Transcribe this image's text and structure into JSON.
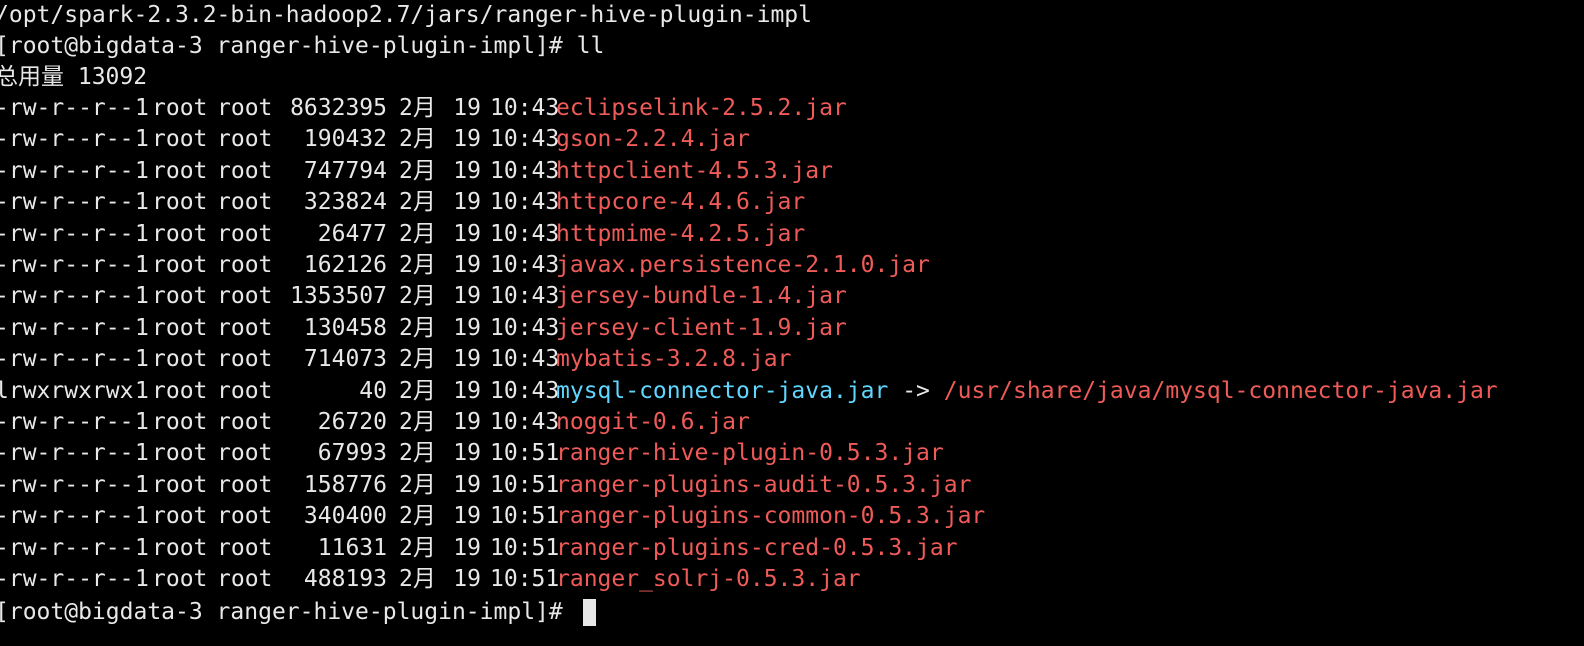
{
  "terminal": {
    "path_line": "/opt/spark-2.3.2-bin-hadoop2.7/jars/ranger-hive-plugin-impl",
    "prompt": "[root@bigdata-3 ranger-hive-plugin-impl]# ",
    "command": "ll",
    "total_line": "总用量 13092",
    "final_prompt": "[root@bigdata-3 ranger-hive-plugin-impl]# ",
    "colors": {
      "background": "#000000",
      "text": "#e8e8e8",
      "file": "#ef5b58",
      "symlink": "#5fd7ff"
    }
  },
  "listing": [
    {
      "perms": "-rw-r--r--",
      "links": "1",
      "owner": "root",
      "group": "root",
      "size": "8632395",
      "month": "2月",
      "day": "19",
      "time": "10:43",
      "name": "eclipselink-2.5.2.jar"
    },
    {
      "perms": "-rw-r--r--",
      "links": "1",
      "owner": "root",
      "group": "root",
      "size": "190432",
      "month": "2月",
      "day": "19",
      "time": "10:43",
      "name": "gson-2.2.4.jar"
    },
    {
      "perms": "-rw-r--r--",
      "links": "1",
      "owner": "root",
      "group": "root",
      "size": "747794",
      "month": "2月",
      "day": "19",
      "time": "10:43",
      "name": "httpclient-4.5.3.jar"
    },
    {
      "perms": "-rw-r--r--",
      "links": "1",
      "owner": "root",
      "group": "root",
      "size": "323824",
      "month": "2月",
      "day": "19",
      "time": "10:43",
      "name": "httpcore-4.4.6.jar"
    },
    {
      "perms": "-rw-r--r--",
      "links": "1",
      "owner": "root",
      "group": "root",
      "size": "26477",
      "month": "2月",
      "day": "19",
      "time": "10:43",
      "name": "httpmime-4.2.5.jar"
    },
    {
      "perms": "-rw-r--r--",
      "links": "1",
      "owner": "root",
      "group": "root",
      "size": "162126",
      "month": "2月",
      "day": "19",
      "time": "10:43",
      "name": "javax.persistence-2.1.0.jar"
    },
    {
      "perms": "-rw-r--r--",
      "links": "1",
      "owner": "root",
      "group": "root",
      "size": "1353507",
      "month": "2月",
      "day": "19",
      "time": "10:43",
      "name": "jersey-bundle-1.4.jar"
    },
    {
      "perms": "-rw-r--r--",
      "links": "1",
      "owner": "root",
      "group": "root",
      "size": "130458",
      "month": "2月",
      "day": "19",
      "time": "10:43",
      "name": "jersey-client-1.9.jar"
    },
    {
      "perms": "-rw-r--r--",
      "links": "1",
      "owner": "root",
      "group": "root",
      "size": "714073",
      "month": "2月",
      "day": "19",
      "time": "10:43",
      "name": "mybatis-3.2.8.jar"
    },
    {
      "perms": "lrwxrwxrwx",
      "links": "1",
      "owner": "root",
      "group": "root",
      "size": "40",
      "month": "2月",
      "day": "19",
      "time": "10:43",
      "name": "mysql-connector-java.jar",
      "arrow": "->",
      "target": "/usr/share/java/mysql-connector-java.jar"
    },
    {
      "perms": "-rw-r--r--",
      "links": "1",
      "owner": "root",
      "group": "root",
      "size": "26720",
      "month": "2月",
      "day": "19",
      "time": "10:43",
      "name": "noggit-0.6.jar"
    },
    {
      "perms": "-rw-r--r--",
      "links": "1",
      "owner": "root",
      "group": "root",
      "size": "67993",
      "month": "2月",
      "day": "19",
      "time": "10:51",
      "name": "ranger-hive-plugin-0.5.3.jar"
    },
    {
      "perms": "-rw-r--r--",
      "links": "1",
      "owner": "root",
      "group": "root",
      "size": "158776",
      "month": "2月",
      "day": "19",
      "time": "10:51",
      "name": "ranger-plugins-audit-0.5.3.jar"
    },
    {
      "perms": "-rw-r--r--",
      "links": "1",
      "owner": "root",
      "group": "root",
      "size": "340400",
      "month": "2月",
      "day": "19",
      "time": "10:51",
      "name": "ranger-plugins-common-0.5.3.jar"
    },
    {
      "perms": "-rw-r--r--",
      "links": "1",
      "owner": "root",
      "group": "root",
      "size": "11631",
      "month": "2月",
      "day": "19",
      "time": "10:51",
      "name": "ranger-plugins-cred-0.5.3.jar"
    },
    {
      "perms": "-rw-r--r--",
      "links": "1",
      "owner": "root",
      "group": "root",
      "size": "488193",
      "month": "2月",
      "day": "19",
      "time": "10:51",
      "name": "ranger_solrj-0.5.3.jar"
    }
  ]
}
